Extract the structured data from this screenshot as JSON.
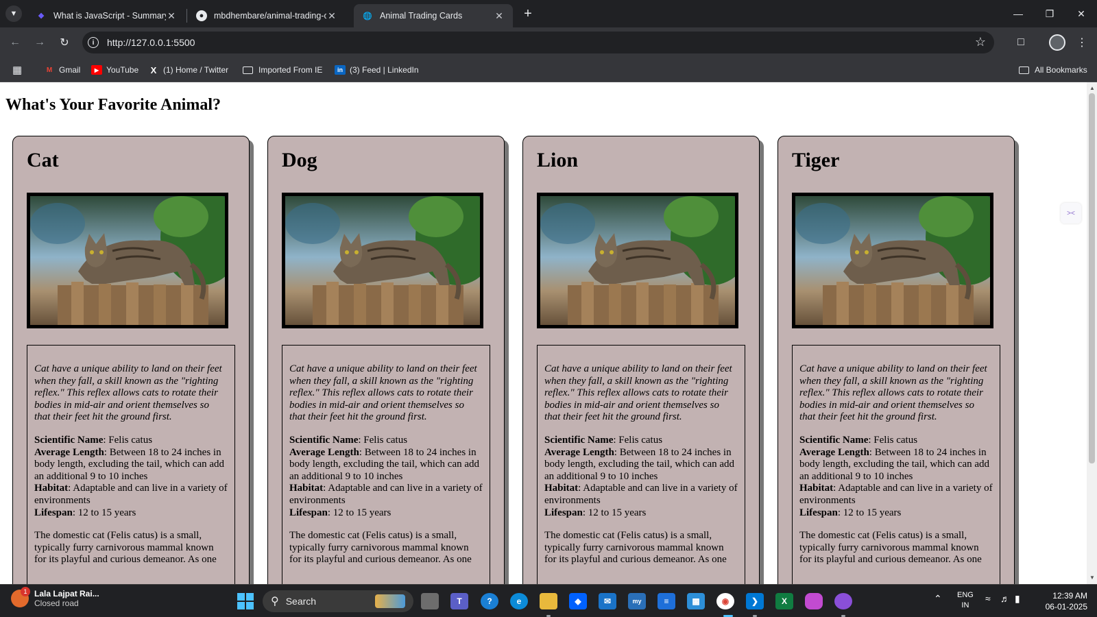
{
  "browser": {
    "tabs": [
      {
        "title": "What is JavaScript - Summary",
        "favicon": "book-icon",
        "active": false
      },
      {
        "title": "mbdhembare/animal-trading-c",
        "favicon": "github-icon",
        "active": false
      },
      {
        "title": "Animal Trading Cards",
        "favicon": "globe-icon",
        "active": true
      }
    ],
    "url": "http://127.0.0.1:5500",
    "bookmarks": [
      {
        "label": "Gmail",
        "icon": "gmail-icon"
      },
      {
        "label": "YouTube",
        "icon": "youtube-icon"
      },
      {
        "label": "(1) Home / Twitter",
        "icon": "x-icon"
      },
      {
        "label": "Imported From IE",
        "icon": "folder-icon"
      },
      {
        "label": "(3) Feed | LinkedIn",
        "icon": "linkedin-icon"
      }
    ],
    "all_bookmarks_label": "All Bookmarks"
  },
  "page": {
    "heading": "What's Your Favorite Animal?",
    "cards": [
      {
        "name": "Cat",
        "description": "Cat have a unique ability to land on their feet when they fall, a skill known as the \"righting reflex.\" This reflex allows cats to rotate their bodies in mid-air and orient themselves so that their feet hit the ground first.",
        "facts": [
          {
            "label": "Scientific Name",
            "value": ": Felis catus"
          },
          {
            "label": "Average Length",
            "value": ": Between 18 to 24 inches in body length, excluding the tail, which can add an additional 9 to 10 inches"
          },
          {
            "label": "Habitat",
            "value": ": Adaptable and can live in a variety of environments"
          },
          {
            "label": "Lifespan",
            "value": ": 12 to 15 years"
          }
        ],
        "more": "The domestic cat (Felis catus) is a small, typically furry carnivorous mammal known for its playful and curious demeanor. As one"
      },
      {
        "name": "Dog",
        "description": "Cat have a unique ability to land on their feet when they fall, a skill known as the \"righting reflex.\" This reflex allows cats to rotate their bodies in mid-air and orient themselves so that their feet hit the ground first.",
        "facts": [
          {
            "label": "Scientific Name",
            "value": ": Felis catus"
          },
          {
            "label": "Average Length",
            "value": ": Between 18 to 24 inches in body length, excluding the tail, which can add an additional 9 to 10 inches"
          },
          {
            "label": "Habitat",
            "value": ": Adaptable and can live in a variety of environments"
          },
          {
            "label": "Lifespan",
            "value": ": 12 to 15 years"
          }
        ],
        "more": "The domestic cat (Felis catus) is a small, typically furry carnivorous mammal known for its playful and curious demeanor. As one"
      },
      {
        "name": "Lion",
        "description": "Cat have a unique ability to land on their feet when they fall, a skill known as the \"righting reflex.\" This reflex allows cats to rotate their bodies in mid-air and orient themselves so that their feet hit the ground first.",
        "facts": [
          {
            "label": "Scientific Name",
            "value": ": Felis catus"
          },
          {
            "label": "Average Length",
            "value": ": Between 18 to 24 inches in body length, excluding the tail, which can add an additional 9 to 10 inches"
          },
          {
            "label": "Habitat",
            "value": ": Adaptable and can live in a variety of environments"
          },
          {
            "label": "Lifespan",
            "value": ": 12 to 15 years"
          }
        ],
        "more": "The domestic cat (Felis catus) is a small, typically furry carnivorous mammal known for its playful and curious demeanor. As one"
      },
      {
        "name": "Tiger",
        "description": "Cat have a unique ability to land on their feet when they fall, a skill known as the \"righting reflex.\" This reflex allows cats to rotate their bodies in mid-air and orient themselves so that their feet hit the ground first.",
        "facts": [
          {
            "label": "Scientific Name",
            "value": ": Felis catus"
          },
          {
            "label": "Average Length",
            "value": ": Between 18 to 24 inches in body length, excluding the tail, which can add an additional 9 to 10 inches"
          },
          {
            "label": "Habitat",
            "value": ": Adaptable and can live in a variety of environments"
          },
          {
            "label": "Lifespan",
            "value": ": 12 to 15 years"
          }
        ],
        "more": "The domestic cat (Felis catus) is a small, typically furry carnivorous mammal known for its playful and curious demeanor. As one"
      }
    ],
    "card_background": "#c2b2b2"
  },
  "taskbar": {
    "weather_title": "Lala Lajpat Rai...",
    "weather_subtitle": "Closed road",
    "weather_badge": "1",
    "search_label": "Search",
    "language_line1": "ENG",
    "language_line2": "IN",
    "time": "12:39 AM",
    "date": "06-01-2025"
  }
}
